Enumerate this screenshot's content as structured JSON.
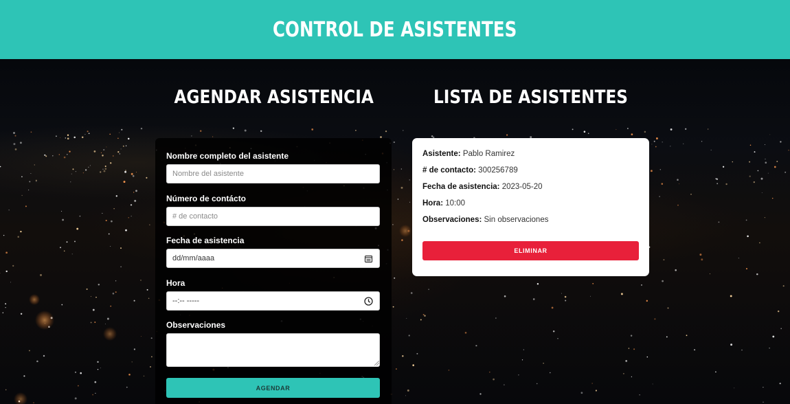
{
  "header": {
    "title": "CONTROL DE ASISTENTES"
  },
  "form": {
    "title": "AGENDAR ASISTENCIA",
    "name_label": "Nombre completo del asistente",
    "name_placeholder": "Nombre del asistente",
    "contact_label": "Número de contácto",
    "contact_placeholder": "# de contacto",
    "date_label": "Fecha de asistencia",
    "date_value": "dd/mm/aaaa",
    "time_label": "Hora",
    "time_value": "--:-- -----",
    "notes_label": "Observaciones",
    "notes_value": "",
    "submit_label": "AGENDAR"
  },
  "list": {
    "title": "LISTA DE ASISTENTES",
    "entries": [
      {
        "name_label": "Asistente:",
        "name": "Pablo Ramirez",
        "contact_label": "# de contacto:",
        "contact": "300256789",
        "date_label": "Fecha de asistencia:",
        "date": "2023-05-20",
        "time_label": "Hora:",
        "time": "10:00",
        "notes_label": "Observaciones:",
        "notes": "Sin observaciones",
        "delete_label": "ELIMINAR"
      }
    ]
  },
  "colors": {
    "accent": "#2ec4b6",
    "danger": "#e8203a",
    "background": "#05070b"
  },
  "icons": {
    "date": "calendar-icon",
    "time": "clock-icon"
  }
}
